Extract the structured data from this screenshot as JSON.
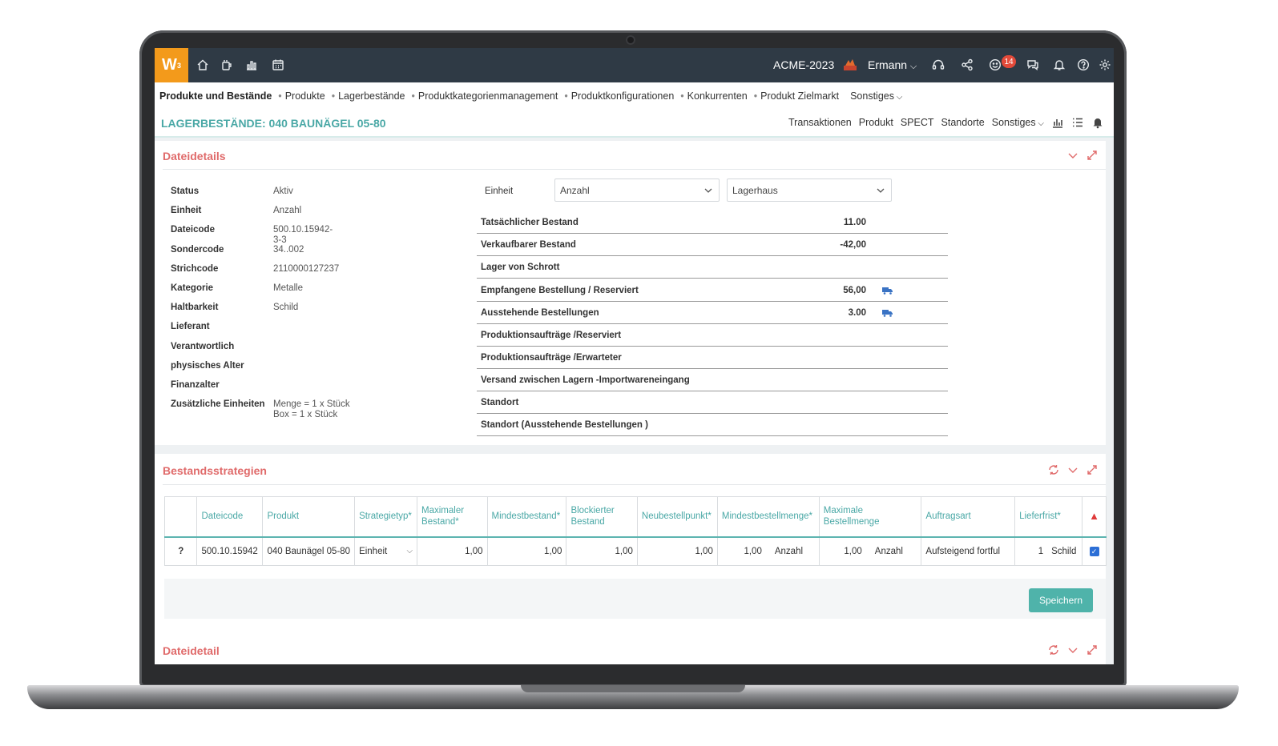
{
  "app": {
    "logo": "W",
    "logo_sup": "3",
    "company": "ACME-2023",
    "user": "Ermann",
    "notifications": "14"
  },
  "topbar_icons": [
    "home-icon",
    "coffee-icon",
    "chart-icon",
    "calendar-icon"
  ],
  "topbar_right_icons": [
    "headset-icon",
    "share-icon",
    "smiley-icon",
    "chat-icon",
    "bell-icon",
    "help-icon",
    "gear-icon"
  ],
  "nav": {
    "items": [
      "Produkte und Bestände",
      "Produkte",
      "Lagerbestände",
      "Produktkategorienmanagement",
      "Produktkonfigurationen",
      "Konkurrenten",
      "Produkt Zielmarkt"
    ],
    "more": "Sonstiges"
  },
  "page": {
    "title": "LAGERBESTÄNDE: 040 BAUNÄGEL 05-80",
    "links": [
      "Transaktionen",
      "Produkt",
      "SPECT",
      "Standorte"
    ],
    "more": "Sonstiges"
  },
  "details": {
    "title": "Dateidetails",
    "fields": [
      {
        "label": "Status",
        "value": "Aktiv"
      },
      {
        "label": "Einheit",
        "value": "Anzahl"
      },
      {
        "label": "Dateicode",
        "value": "500.10.15942-3-3"
      },
      {
        "label": "Sondercode",
        "value": "34..002"
      },
      {
        "label": "Strichcode",
        "value": "2110000127237"
      },
      {
        "label": "Kategorie",
        "value": "Metalle"
      },
      {
        "label": "Haltbarkeit",
        "value": "Schild"
      },
      {
        "label": "Lieferant",
        "value": ""
      },
      {
        "label": "Verantwortlich",
        "value": ""
      },
      {
        "label": "physisches Alter",
        "value": ""
      },
      {
        "label": "Finanzalter",
        "value": ""
      },
      {
        "label": "Zusätzliche Einheiten",
        "value": "Menge = 1 x Stück",
        "value2": "Box = 1 x Stück"
      }
    ],
    "unit_label": "Einheit",
    "unit_select": "Anzahl",
    "warehouse_select": "Lagerhaus",
    "stock": [
      {
        "label": "Tatsächlicher Bestand",
        "value": "11.00",
        "truck": false
      },
      {
        "label": "Verkaufbarer Bestand",
        "value": "-42,00",
        "truck": false
      },
      {
        "label": "Lager von Schrott",
        "value": "",
        "truck": false
      },
      {
        "label": "Empfangene Bestellung / Reserviert",
        "value": "56,00",
        "truck": true
      },
      {
        "label": "Ausstehende Bestellungen",
        "value": "3.00",
        "truck": true
      },
      {
        "label": "Produktionsaufträge /Reserviert",
        "value": "",
        "truck": false
      },
      {
        "label": "Produktionsaufträge /Erwarteter",
        "value": "",
        "truck": false
      },
      {
        "label": "Versand zwischen Lagern -Importwareneingang",
        "value": "",
        "truck": false
      },
      {
        "label": "Standort",
        "value": "",
        "truck": false
      },
      {
        "label": "Standort (Ausstehende Bestellungen )",
        "value": "",
        "truck": false
      }
    ]
  },
  "strategies": {
    "title": "Bestandsstrategien",
    "headers": [
      "Dateicode",
      "Produkt",
      "Strategietyp*",
      "Maximaler Bestand*",
      "Mindestbestand*",
      "Blockierter Bestand",
      "Neubestellpunkt*",
      "Mindestbestellmenge*",
      "Maximale Bestellmenge",
      "Auftragsart",
      "Lieferfrist*"
    ],
    "row": {
      "flag": "?",
      "dateicode": "500.10.15942",
      "produkt": "040 Baunägel 05-80",
      "strategietyp": "Einheit",
      "max_bestand": "1,00",
      "min_bestand": "1,00",
      "blockiert": "1,00",
      "neubestellpunkt": "1,00",
      "min_menge": "1,00",
      "min_menge_unit": "Anzahl",
      "max_menge": "1,00",
      "max_menge_unit": "Anzahl",
      "auftragsart": "Aufsteigend fortful",
      "lieferfrist": "1",
      "lieferfrist_unit": "Schild",
      "checked": true
    },
    "save_label": "Speichern"
  },
  "detail2": {
    "title": "Dateidetail"
  }
}
